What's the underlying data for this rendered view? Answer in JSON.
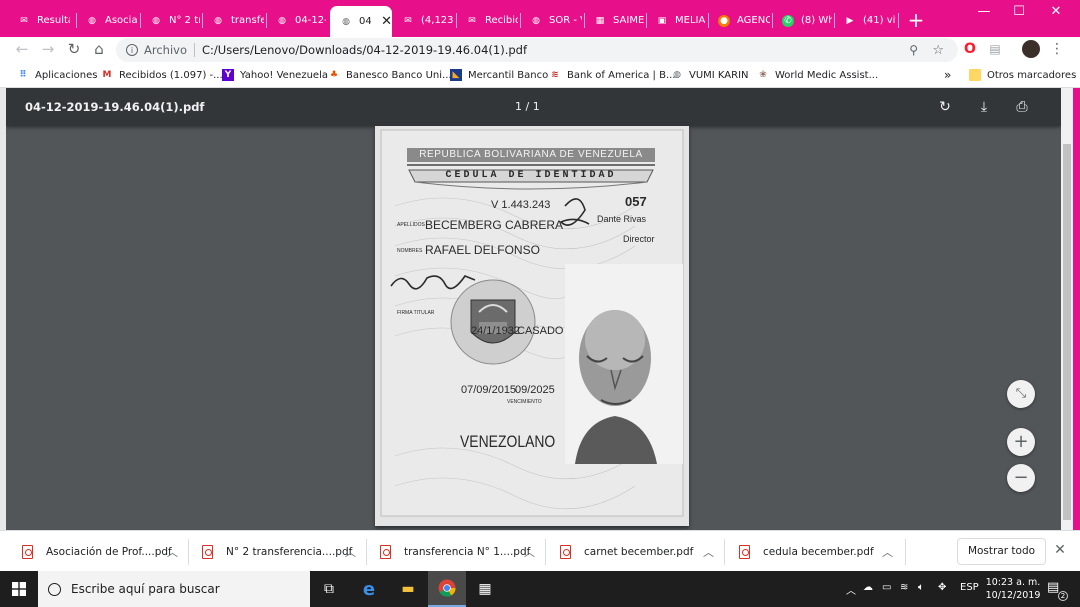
{
  "tabs": [
    {
      "label": "Resulta",
      "icon": "gmail-icon"
    },
    {
      "label": "Asociac",
      "icon": "globe-icon"
    },
    {
      "label": "N° 2 tra",
      "icon": "globe-icon"
    },
    {
      "label": "transfer",
      "icon": "globe-icon"
    },
    {
      "label": "04-12-2",
      "icon": "globe-icon"
    },
    {
      "label": "04-",
      "icon": "globe-icon",
      "active": true
    },
    {
      "label": "(4,123",
      "icon": "yahoo-mail-icon"
    },
    {
      "label": "Recibid",
      "icon": "gmail-icon"
    },
    {
      "label": "SOR - V",
      "icon": "globe-icon"
    },
    {
      "label": "SAIME",
      "icon": "saime-icon"
    },
    {
      "label": "MELIA",
      "icon": "melia-icon"
    },
    {
      "label": "AGENC",
      "icon": "agency-icon"
    },
    {
      "label": "(8) Wha",
      "icon": "whatsapp-icon"
    },
    {
      "label": "(41) viv",
      "icon": "youtube-icon"
    }
  ],
  "window": {
    "minimize": "—",
    "maximize": "☐",
    "close": "✕",
    "new_tab": "+"
  },
  "address": {
    "scheme": "Archivo",
    "url": "C:/Users/Lenovo/Downloads/04-12-2019-19.46.04(1).pdf"
  },
  "bookmarks": [
    {
      "label": "Aplicaciones",
      "icon": "apps-grid-icon"
    },
    {
      "label": "Recibidos (1.097) -...",
      "icon": "gmail-icon"
    },
    {
      "label": "Yahoo! Venezuela",
      "icon": "yahoo-icon"
    },
    {
      "label": "Banesco Banco Uni...",
      "icon": "banesco-icon"
    },
    {
      "label": "Mercantil Banco",
      "icon": "mercantil-icon"
    },
    {
      "label": "Bank of America | B...",
      "icon": "bofa-icon"
    },
    {
      "label": "VUMI KARIN",
      "icon": "globe-icon"
    },
    {
      "label": "World Medic Assist...",
      "icon": "world-medic-icon"
    }
  ],
  "bookmarks_overflow": "»",
  "other_bookmarks": "Otros marcadores",
  "pdf": {
    "title": "04-12-2019-19.46.04(1).pdf",
    "pages": "1 / 1",
    "document": {
      "republic": "REPUBLICA BOLIVARIANA DE VENEZUELA",
      "doc_type": "CEDULA DE IDENTIDAD",
      "id_number": "V 1.443.243",
      "code": "057",
      "apellidos_label": "APELLIDOS",
      "apellidos": "BECEMBERG CABRERA",
      "nombres_label": "NOMBRES",
      "nombres": "RAFAEL DELFONSO",
      "director_name": "Dante Rivas",
      "director_title": "Director",
      "firma_label": "FIRMA TITULAR",
      "birth_date": "24/1/1932",
      "civil_status": "CASADO",
      "issue_date": "07/09/2015",
      "expiry_date": "09/2025",
      "vencimiento_label": "VENCIMIENTO",
      "nationality": "VENEZOLANO"
    }
  },
  "downloads": [
    {
      "label": "Asociación de Prof....pdf"
    },
    {
      "label": "N° 2  transferencia....pdf"
    },
    {
      "label": "transferencia  N° 1....pdf"
    },
    {
      "label": "carnet becember.pdf"
    },
    {
      "label": "cedula becember.pdf"
    }
  ],
  "show_all": "Mostrar todo",
  "taskbar": {
    "search_placeholder": "Escribe aquí para buscar",
    "lang": "ESP",
    "time": "10:23 a. m.",
    "date": "10/12/2019",
    "notifications": "2"
  }
}
